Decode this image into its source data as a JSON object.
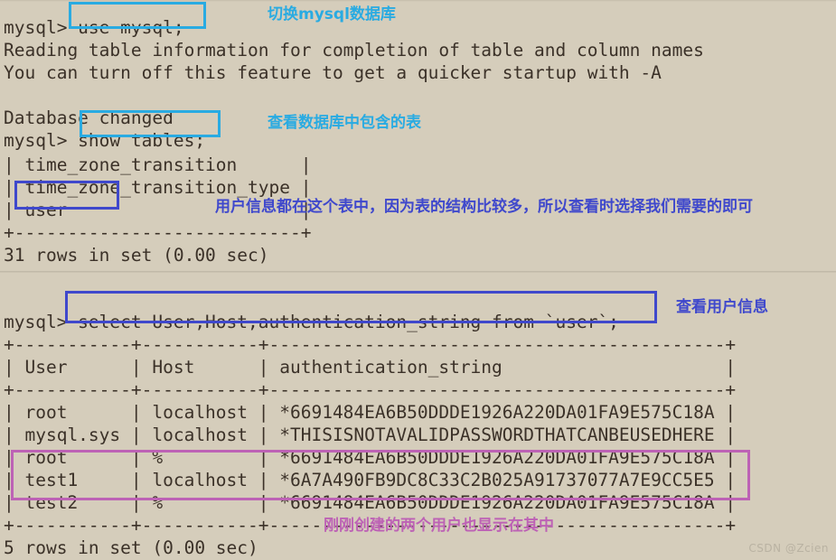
{
  "meta": {
    "background_color": "#d5cdbb",
    "text_color": "#3b3128",
    "accent_cyan": "#29abe2",
    "accent_blue": "#3f48cc",
    "accent_pink": "#bd62b5",
    "watermark": "CSDN @Zcien"
  },
  "top_pane": {
    "lines": [
      "mysql> use mysql;",
      "Reading table information for completion of table and column names",
      "You can turn off this feature to get a quicker startup with -A",
      "",
      "Database changed",
      "mysql> show tables;"
    ]
  },
  "mid_pane": {
    "lines": [
      "| time_zone_transition      |",
      "| time_zone_transition_type |",
      "| user                      |",
      "+---------------------------+",
      "31 rows in set (0.00 sec)"
    ]
  },
  "bottom_pane": {
    "lines": [
      "mysql> select User,Host,authentication_string from `user`;",
      "+-----------+-----------+-------------------------------------------+",
      "| User      | Host      | authentication_string                     |",
      "+-----------+-----------+-------------------------------------------+",
      "| root      | localhost | *6691484EA6B50DDDE1926A220DA01FA9E575C18A |",
      "| mysql.sys | localhost | *THISISNOTAVALIDPASSWORDTHATCANBEUSEDHERE |",
      "| root      | %         | *6691484EA6B50DDDE1926A220DA01FA9E575C18A |",
      "| test1     | localhost | *6A7A490FB9DC8C33C2B025A91737077A7E9CC5E5 |",
      "| test2     | %         | *6691484EA6B50DDDE1926A220DA01FA9E575C18A |",
      "+-----------+-----------+-------------------------------------------+",
      "5 rows in set (0.00 sec)"
    ],
    "table": {
      "columns": [
        "User",
        "Host",
        "authentication_string"
      ],
      "rows": [
        [
          "root",
          "localhost",
          "*6691484EA6B50DDDE1926A220DA01FA9E575C18A"
        ],
        [
          "mysql.sys",
          "localhost",
          "*THISISNOTAVALIDPASSWORDTHATCANBEUSEDHERE"
        ],
        [
          "root",
          "%",
          "*6691484EA6B50DDDE1926A220DA01FA9E575C18A"
        ],
        [
          "test1",
          "localhost",
          "*6A7A490FB9DC8C33C2B025A91737077A7E9CC5E5"
        ],
        [
          "test2",
          "%",
          "*6691484EA6B50DDDE1926A220DA01FA9E575C18A"
        ]
      ],
      "row_count_text": "5 rows in set (0.00 sec)"
    }
  },
  "annotations": {
    "use_mysql": "切换mysql数据库",
    "show_tables": "查看数据库中包含的表",
    "user_table": "用户信息都在这个表中，因为表的结构比较多，所以查看时选择我们需要的即可",
    "select_users": "查看用户信息",
    "new_users": "刚刚创建的两个用户也显示在其中"
  },
  "commands": {
    "use_mysql": "use mysql;",
    "show_tables": "show tables;",
    "select_users": "select User,Host,authentication_string from `user`;",
    "user_row": "user"
  }
}
